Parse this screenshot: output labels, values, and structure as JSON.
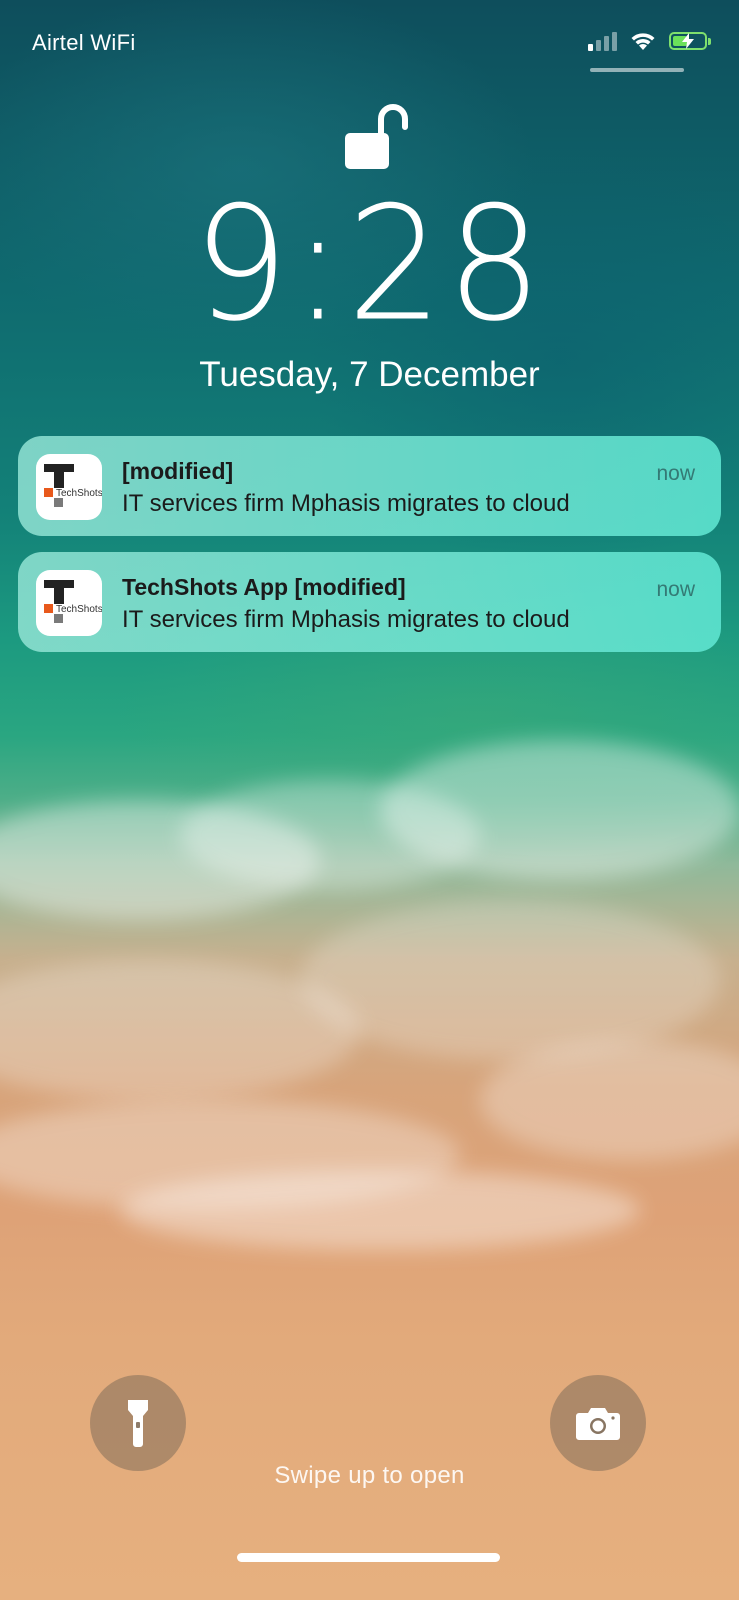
{
  "status_bar": {
    "carrier": "Airtel WiFi",
    "signal_bars_total": 4,
    "signal_bars_active": 1,
    "wifi_icon": "wifi-icon",
    "battery_icon": "battery-charging-icon",
    "battery_color": "#6be05a"
  },
  "lock_screen": {
    "lock_icon": "unlocked-padlock-icon",
    "time": "9:28",
    "date": "Tuesday, 7 December"
  },
  "notifications": [
    {
      "app_icon": "techshots-logo",
      "logo_text": "TechShots",
      "title": " [modified]",
      "time": "now",
      "body": "IT services firm Mphasis migrates to cloud"
    },
    {
      "app_icon": "techshots-logo",
      "logo_text": "TechShots",
      "title": "TechShots App [modified]",
      "time": "now",
      "body": "IT services firm Mphasis migrates to cloud"
    }
  ],
  "bottom": {
    "flashlight_icon": "flashlight-icon",
    "camera_icon": "camera-icon",
    "swipe_hint": "Swipe up to open"
  }
}
